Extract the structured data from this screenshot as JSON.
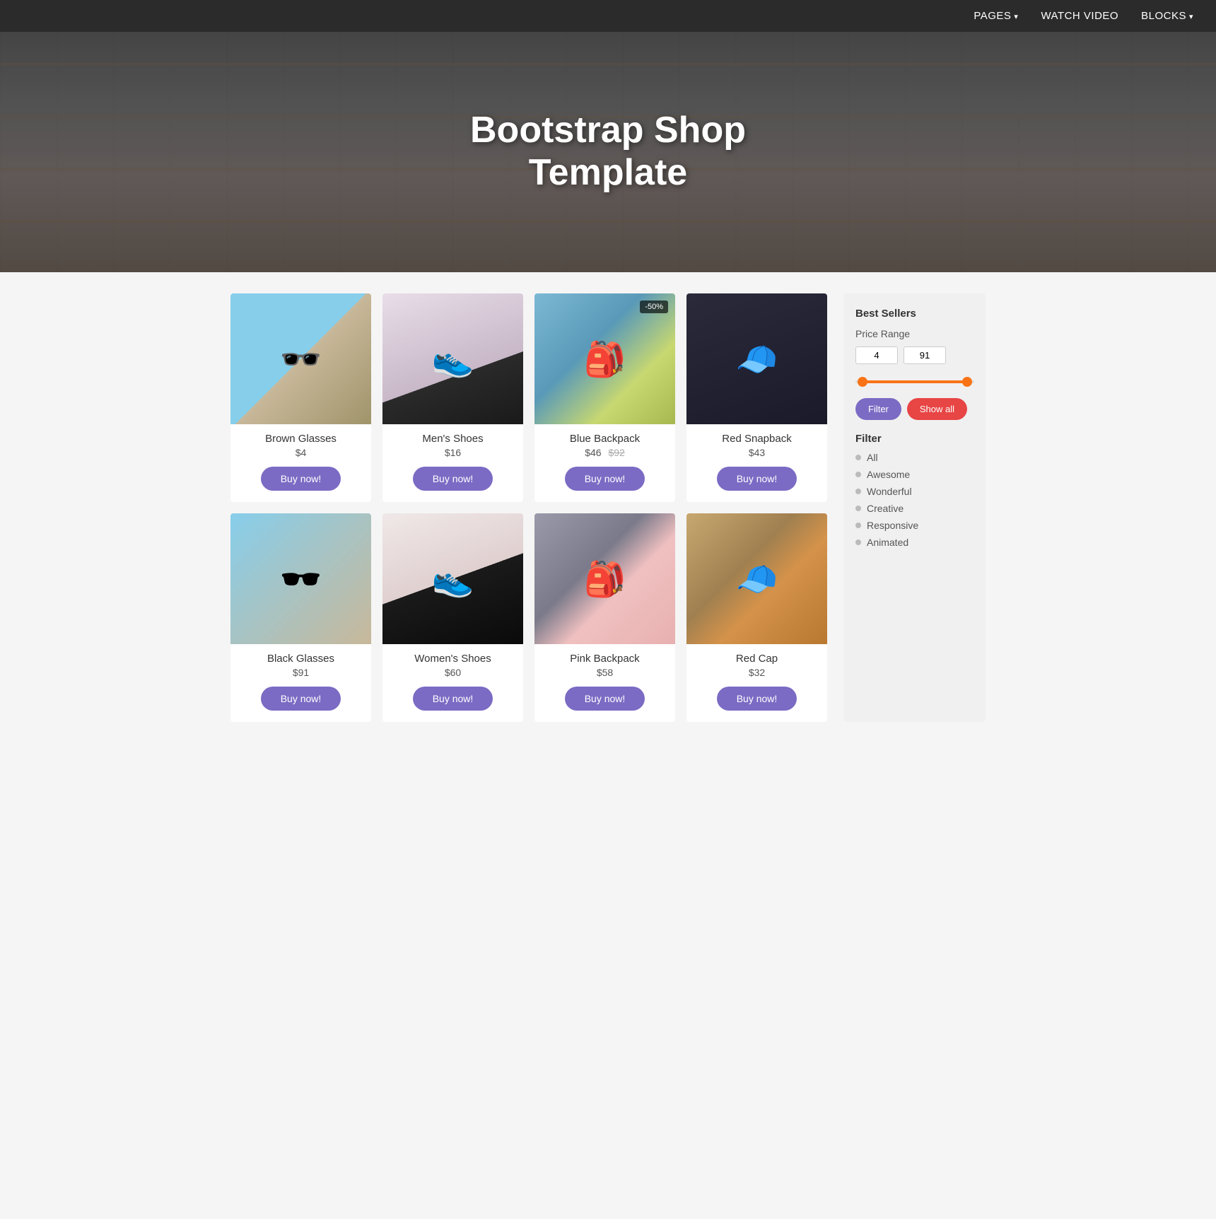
{
  "nav": {
    "items": [
      {
        "label": "PAGES",
        "caret": true
      },
      {
        "label": "WATCH VIDEO",
        "caret": false
      },
      {
        "label": "BLOCKS",
        "caret": true
      }
    ]
  },
  "hero": {
    "title_line1": "Bootstrap Shop",
    "title_line2": "Template"
  },
  "products": [
    {
      "id": "brown-glasses",
      "name": "Brown Glasses",
      "price": "$4",
      "original_price": null,
      "discount": null,
      "img_class": "img-brown-glasses"
    },
    {
      "id": "mens-shoes",
      "name": "Men's Shoes",
      "price": "$16",
      "original_price": null,
      "discount": null,
      "img_class": "img-mens-shoes"
    },
    {
      "id": "blue-backpack",
      "name": "Blue Backpack",
      "price": "$46",
      "original_price": "$92",
      "discount": "-50%",
      "img_class": "img-blue-backpack"
    },
    {
      "id": "red-snapback",
      "name": "Red Snapback",
      "price": "$43",
      "original_price": null,
      "discount": null,
      "img_class": "img-red-snapback"
    },
    {
      "id": "black-glasses",
      "name": "Black Glasses",
      "price": "$91",
      "original_price": null,
      "discount": null,
      "img_class": "img-black-glasses"
    },
    {
      "id": "womens-shoes",
      "name": "Women's Shoes",
      "price": "$60",
      "original_price": null,
      "discount": null,
      "img_class": "img-womens-shoes"
    },
    {
      "id": "pink-backpack",
      "name": "Pink Backpack",
      "price": "$58",
      "original_price": null,
      "discount": null,
      "img_class": "img-pink-backpack"
    },
    {
      "id": "red-cap",
      "name": "Red Cap",
      "price": "$32",
      "original_price": null,
      "discount": null,
      "img_class": "img-red-cap"
    }
  ],
  "buy_label": "Buy now!",
  "sidebar": {
    "best_sellers_label": "Best Sellers",
    "price_range_label": "Price Range",
    "price_min": "4",
    "price_max": "91",
    "filter_btn_label": "Filter",
    "show_all_btn_label": "Show all",
    "filter_section_label": "Filter",
    "filter_items": [
      {
        "label": "All"
      },
      {
        "label": "Awesome"
      },
      {
        "label": "Wonderful"
      },
      {
        "label": "Creative"
      },
      {
        "label": "Responsive"
      },
      {
        "label": "Animated"
      }
    ]
  }
}
